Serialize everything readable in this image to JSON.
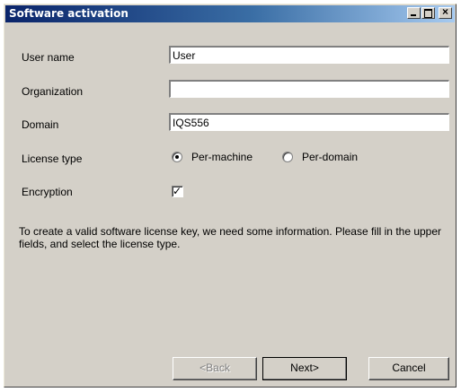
{
  "window": {
    "title": "Software activation",
    "buttons": {
      "minimize": "minimize",
      "maximize": "maximize",
      "close": "close"
    }
  },
  "form": {
    "user_name": {
      "label": "User name",
      "value": "User"
    },
    "organization": {
      "label": "Organization",
      "value": ""
    },
    "domain": {
      "label": "Domain",
      "value": "IQS556"
    },
    "license_type": {
      "label": "License type",
      "options": [
        {
          "label": "Per-machine",
          "selected": true
        },
        {
          "label": "Per-domain",
          "selected": false
        }
      ]
    },
    "encryption": {
      "label": "Encryption",
      "checked": true
    }
  },
  "info_text": "To create a valid software license key, we need some information. Please fill in the upper fields, and select the license type.",
  "footer": {
    "back_label": "<Back",
    "next_label": "Next>",
    "cancel_label": "Cancel"
  },
  "colors": {
    "title_start": "#0a246a",
    "title_end": "#a6caf0",
    "window_bg": "#d4d0c8"
  }
}
